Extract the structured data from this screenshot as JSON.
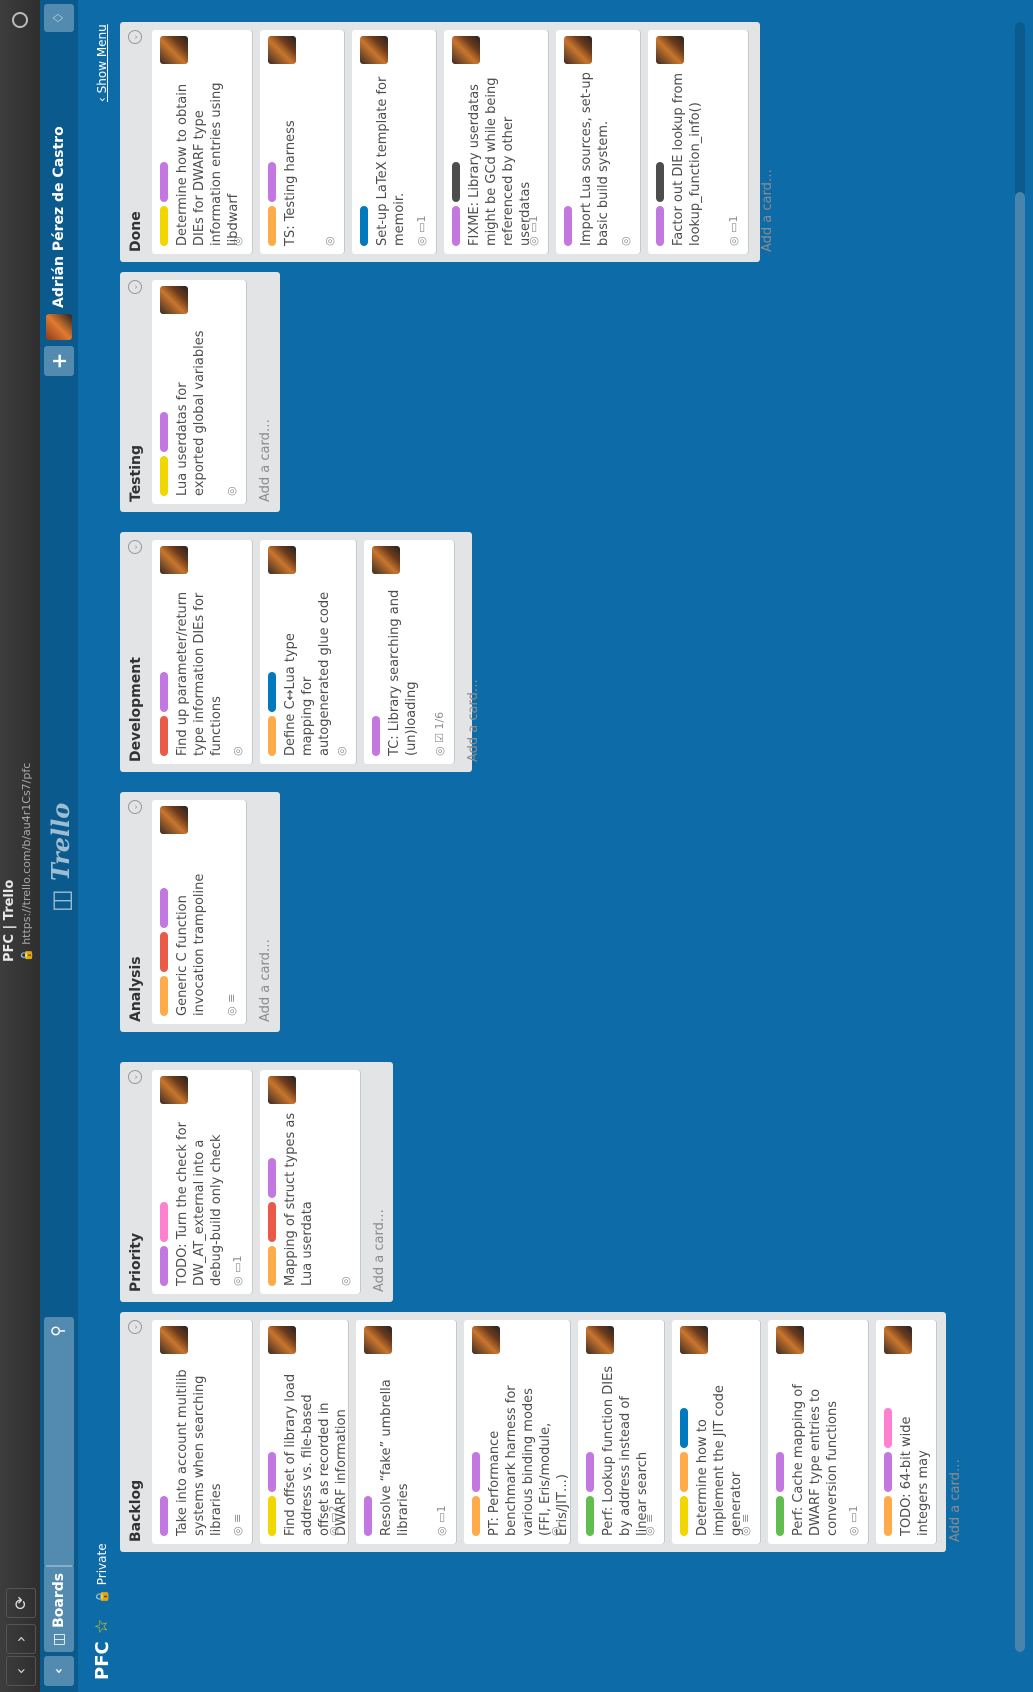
{
  "browser": {
    "title": "PFC | Trello",
    "url": "https://trello.com/b/au4r1Cs7/pfc"
  },
  "header": {
    "boards_label": "Boards",
    "logo": "Trello",
    "user_name": "Adrián Pérez de Castro",
    "add_label": "+"
  },
  "board": {
    "name": "PFC",
    "visibility": "Private",
    "show_menu": "Show Menu"
  },
  "colors": {
    "purple": "#c377e0",
    "yellow": "#f2d600",
    "orange": "#ffab4a",
    "red": "#eb5a46",
    "pink": "#ff80ce",
    "blue": "#0079bf",
    "green": "#61bd4f",
    "black": "#4d4d4d",
    "board_bg": "#0c6aa8"
  },
  "lists": [
    {
      "title": "Backlog",
      "add_card": "Add a card…",
      "cards": [
        {
          "title": "Take into account multilib systems when searching libraries",
          "labels": [
            "purple"
          ],
          "badges": "◎  ≡"
        },
        {
          "title": "Find offset of library load address vs. file-based offset as recorded in DWARF information",
          "labels": [
            "yellow",
            "purple"
          ],
          "badges": "◎  ▭2"
        },
        {
          "title": "Resolve “fake” umbrella libraries",
          "labels": [
            "purple"
          ],
          "badges": "◎  ▭1"
        },
        {
          "title": "PT: Performance benchmark harness for various binding modes (FFI, Eris/module, Eris/JIT…)",
          "labels": [
            "orange",
            "purple"
          ],
          "badges": "◎"
        },
        {
          "title": "Perf: Lookup function DIEs by address instead of linear search",
          "labels": [
            "green",
            "purple"
          ],
          "badges": "◎  ≡"
        },
        {
          "title": "Determine how to implement the JIT code generator",
          "labels": [
            "yellow",
            "orange",
            "blue"
          ],
          "badges": "◎  ≡"
        },
        {
          "title": "Perf: Cache mapping of DWARF type entries to conversion functions",
          "labels": [
            "green",
            "purple"
          ],
          "badges": "◎  ▭1"
        },
        {
          "title": "TODO: 64-bit wide integers may",
          "labels": [
            "orange",
            "purple",
            "pink"
          ],
          "badges": ""
        }
      ]
    },
    {
      "title": "Priority",
      "add_card": "Add a card…",
      "cards": [
        {
          "title": "TODO: Turn the check for DW_AT_external into a debug-build only check",
          "labels": [
            "purple",
            "pink"
          ],
          "badges": "◎  ▭1"
        },
        {
          "title": "Mapping of struct types as Lua userdata",
          "labels": [
            "orange",
            "red",
            "purple"
          ],
          "badges": "◎"
        }
      ]
    },
    {
      "title": "Analysis",
      "add_card": "Add a card…",
      "cards": [
        {
          "title": "Generic C function invocation trampoline",
          "labels": [
            "orange",
            "red",
            "purple"
          ],
          "badges": "◎  ≡"
        }
      ]
    },
    {
      "title": "Development",
      "add_card": "Add a card…",
      "cards": [
        {
          "title": "Find up parameter/return type information DIEs for functions",
          "labels": [
            "red",
            "purple"
          ],
          "badges": "◎"
        },
        {
          "title": "Define C↔Lua type mapping for autogenerated glue code",
          "labels": [
            "orange",
            "blue"
          ],
          "badges": "◎"
        },
        {
          "title": "TC: Library searching and (un)loading",
          "labels": [
            "purple"
          ],
          "badges": "◎  ☑ 1/6"
        }
      ]
    },
    {
      "title": "Testing",
      "add_card": "Add a card…",
      "cards": [
        {
          "title": "Lua userdatas for exported global variables",
          "labels": [
            "yellow",
            "purple"
          ],
          "badges": "◎"
        }
      ]
    },
    {
      "title": "Done",
      "add_card": "Add a card…",
      "cards": [
        {
          "title": "Determine how to obtain DIEs for DWARF type information entries using libdwarf",
          "labels": [
            "yellow",
            "purple"
          ],
          "badges": "◎"
        },
        {
          "title": "TS: Testing harness",
          "labels": [
            "orange",
            "purple"
          ],
          "badges": "◎"
        },
        {
          "title": "Set-up LaTeX template for memoir.",
          "labels": [
            "blue"
          ],
          "badges": "◎  ▭1"
        },
        {
          "title": "FIXME: Library userdatas might be GCd while being referenced by other userdatas",
          "labels": [
            "purple",
            "black"
          ],
          "badges": "◎  ▭1"
        },
        {
          "title": "Import Lua sources, set-up basic build system.",
          "labels": [
            "purple"
          ],
          "badges": "◎"
        },
        {
          "title": "Factor out DIE lookup from lookup_function_info()",
          "labels": [
            "purple",
            "black"
          ],
          "badges": "◎  ▭1"
        }
      ]
    }
  ]
}
